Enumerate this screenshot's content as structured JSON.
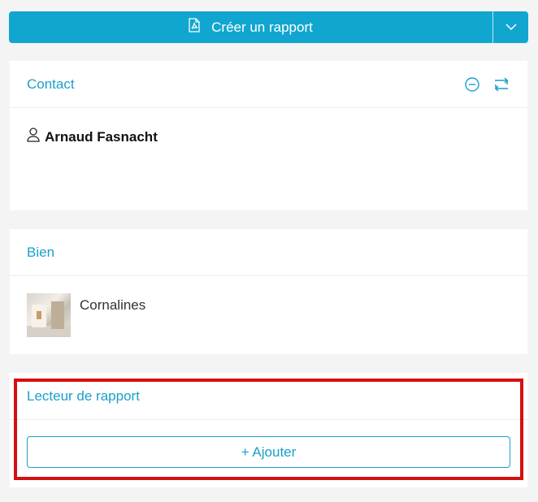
{
  "create_report": {
    "label": "Créer un rapport"
  },
  "contact": {
    "title": "Contact",
    "person_name": "Arnaud Fasnacht"
  },
  "bien": {
    "title": "Bien",
    "property_name": "Cornalines"
  },
  "lecteur": {
    "title": "Lecteur de rapport",
    "add_label": "+ Ajouter"
  },
  "colors": {
    "accent": "#11a6d0",
    "title_blue": "#1a9fcb",
    "highlight_red": "#d50f0f",
    "background": "#f4f4f4"
  },
  "icons": [
    "pdf-file-icon",
    "chevron-down-icon",
    "minus-circle-icon",
    "swap-icon",
    "user-icon"
  ]
}
